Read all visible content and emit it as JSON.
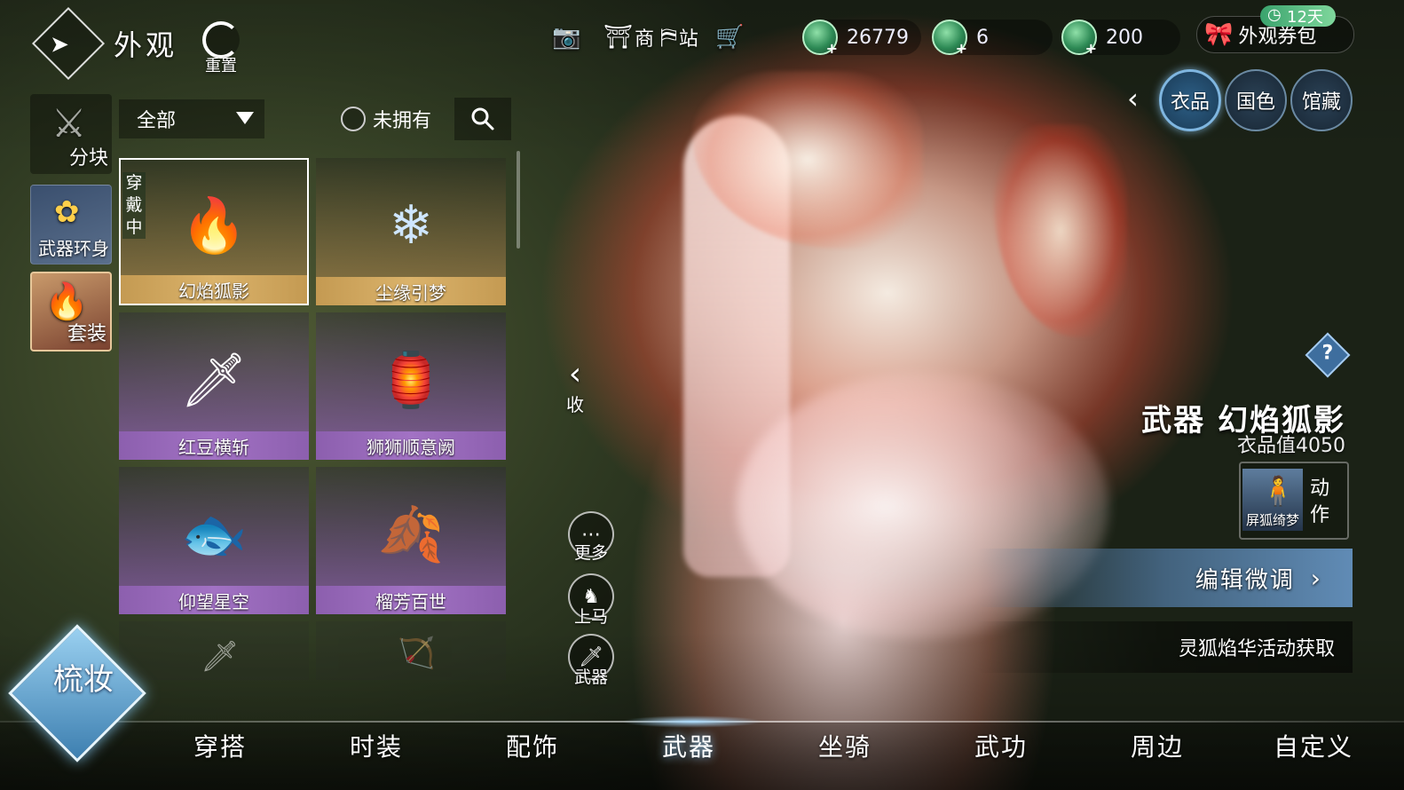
{
  "header": {
    "title": "外观",
    "reset_label": "重置",
    "icons": [
      {
        "name": "camera-icon",
        "glyph": "📷",
        "label": ""
      },
      {
        "name": "shop-icon",
        "glyph": "⛩",
        "label": "商"
      },
      {
        "name": "station-icon",
        "glyph": "⛿",
        "label": "站"
      },
      {
        "name": "cart-icon",
        "glyph": "🛒",
        "label": ""
      }
    ],
    "currencies": [
      {
        "amount": "26779"
      },
      {
        "amount": "6"
      },
      {
        "amount": "200"
      }
    ],
    "pack_label": "外观券包",
    "days_badge": "12天"
  },
  "view_tabs": [
    {
      "label": "衣品",
      "active": true
    },
    {
      "label": "国色",
      "active": false
    },
    {
      "label": "馆藏",
      "active": false
    }
  ],
  "categories": [
    {
      "label": "分块"
    },
    {
      "label": "武器环身"
    },
    {
      "label": "套装"
    }
  ],
  "filter": {
    "selected": "全部",
    "unowned_label": "未拥有"
  },
  "items": [
    {
      "name": "幻焰狐影",
      "rarity": "gold",
      "wearing": true,
      "wearing_label": "穿戴中",
      "art": "🔥"
    },
    {
      "name": "尘缘引梦",
      "rarity": "gold",
      "wearing": false,
      "art": "❄"
    },
    {
      "name": "红豆横斩",
      "rarity": "purple",
      "wearing": false,
      "art": "🗡"
    },
    {
      "name": "狮狮顺意阙",
      "rarity": "purple",
      "wearing": false,
      "art": "🏮"
    },
    {
      "name": "仰望星空",
      "rarity": "purple",
      "wearing": false,
      "art": "🐟"
    },
    {
      "name": "榴芳百世",
      "rarity": "purple",
      "wearing": false,
      "art": "🍂"
    }
  ],
  "center_controls": {
    "collapse_label": "收",
    "more_label": "更多",
    "mount_label": "上马",
    "weapon_label": "武器"
  },
  "detail": {
    "title": "武器 幻焰狐影",
    "value_label": "衣品值4050",
    "action_caption": "屏狐绮梦",
    "action_label": "动作",
    "edit_label": "编辑微调",
    "source_label": "灵狐焰华活动获取"
  },
  "makeup_label": "梳妆",
  "bottom_tabs": [
    {
      "label": "穿搭",
      "active": false
    },
    {
      "label": "时装",
      "active": false
    },
    {
      "label": "配饰",
      "active": false
    },
    {
      "label": "武器",
      "active": true
    },
    {
      "label": "坐骑",
      "active": false
    },
    {
      "label": "武功",
      "active": false
    },
    {
      "label": "周边",
      "active": false
    },
    {
      "label": "自定义",
      "active": false
    }
  ],
  "colors": {
    "gold_card": "#dbb36b",
    "purple_card": "#a272c4",
    "active_circle": "#7fb6e0",
    "currency_green": "#2d8a55"
  }
}
